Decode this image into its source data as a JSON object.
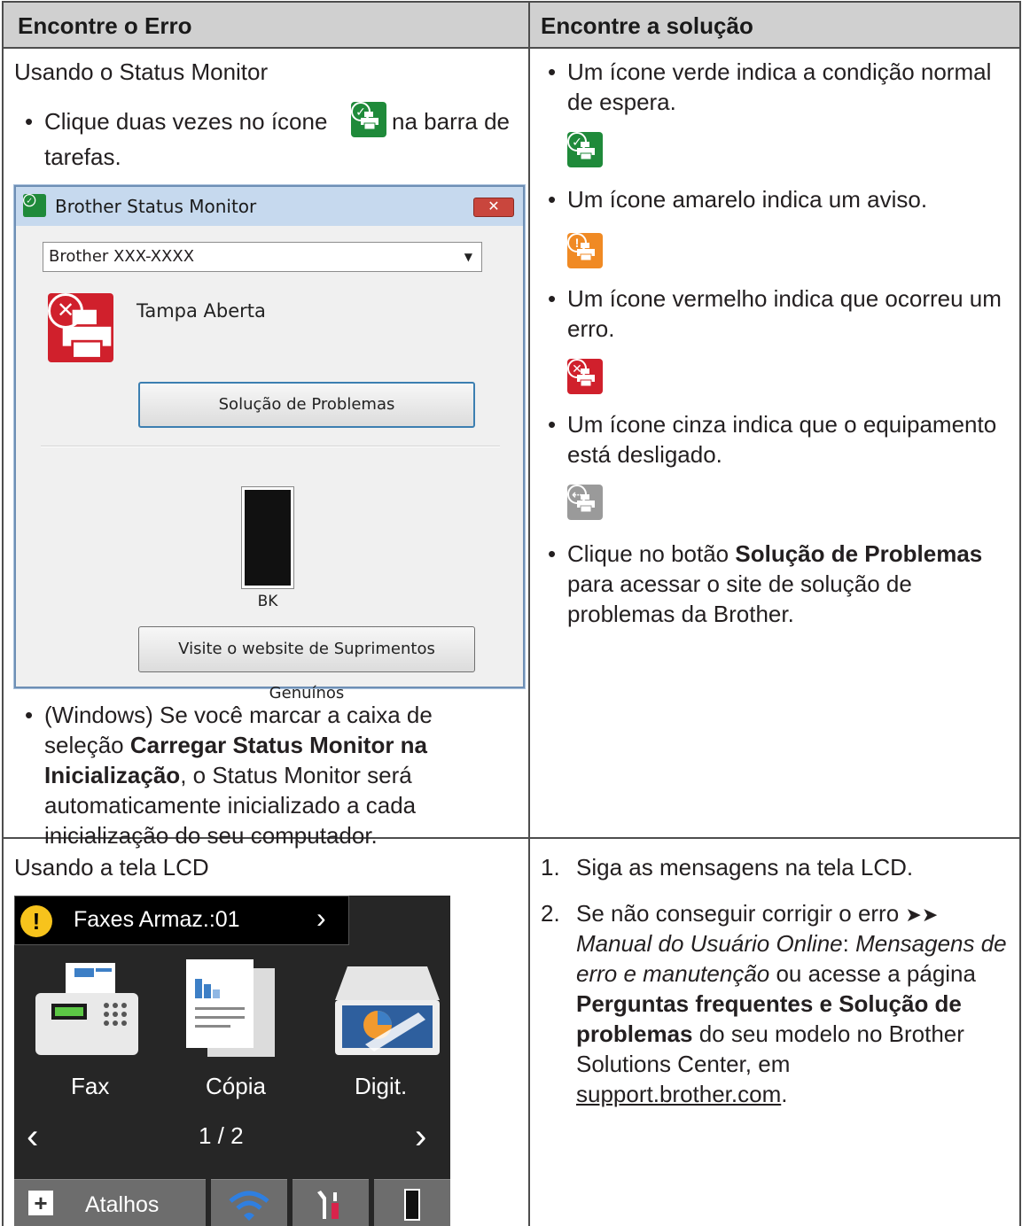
{
  "header": {
    "col1": "Encontre o Erro",
    "col2": "Encontre a solução"
  },
  "status_monitor": {
    "heading": "Usando o Status Monitor",
    "bullet1_part1": "Clique duas vezes no ícone",
    "bullet1_part2": "na barra de",
    "bullet1_line2": "tarefas.",
    "window": {
      "title": "Brother Status Monitor",
      "close_glyph": "✕",
      "dropdown_value": "Brother XXX-XXXX",
      "status": "Tampa Aberta",
      "troubleshoot_button": "Solução de Problemas",
      "ink_label": "BK",
      "supplies_button": "Visite o website de Suprimentos Genuínos"
    },
    "windows_note": {
      "line1": "(Windows) Se você marcar a caixa de",
      "line2_pre": "seleção ",
      "line2_bold": "Carregar Status Monitor na",
      "line3_bold": "Inicialização",
      "line3_post": ", o Status Monitor será",
      "line4": "automaticamente inicializado a cada",
      "line5": "inicialização do seu computador."
    }
  },
  "solutions": {
    "green_line1": "Um ícone verde indica a condição normal",
    "green_line2": "de espera.",
    "yellow": "Um ícone amarelo indica um aviso.",
    "red_line1": "Um ícone vermelho indica que ocorreu um",
    "red_line2": "erro.",
    "gray_line1": "Um ícone cinza indica que o equipamento",
    "gray_line2": "está desligado.",
    "click_pre": "Clique no botão ",
    "click_bold": "Solução de Problemas",
    "click_line2": "para acessar o site de solução de",
    "click_line3": "problemas da Brother."
  },
  "lcd_section": {
    "heading": "Usando a tela LCD",
    "status_bar": "Faxes Armaz.:01",
    "fax": "Fax",
    "copy": "Cópia",
    "scan": "Digit.",
    "page": "1 / 2",
    "shortcuts": "Atalhos"
  },
  "lcd_steps": {
    "step1_num": "1.",
    "step1": "Siga as mensagens na tela LCD.",
    "step2_num": "2.",
    "step2_line1": "Se não conseguir corrigir o erro",
    "arrows": "➤➤",
    "step2_line2_italic": "Manual do Usuário Online",
    "colon": ": ",
    "step2_line2_italic2": "Mensagens de",
    "step2_line3_italic": "erro e manutenção",
    "step2_line3_post": " ou acesse a página",
    "step2_line4_bold": "Perguntas frequentes e Solução de",
    "step2_line5_bold": "problemas",
    "step2_line5_post": " do seu modelo no Brother",
    "step2_line6": "Solutions Center, em",
    "link": "support.brother.com",
    "period": "."
  },
  "colors": {
    "green": "#1f8a3a",
    "yellow": "#f08a24",
    "red": "#d0202c",
    "gray": "#9a9a9a"
  }
}
